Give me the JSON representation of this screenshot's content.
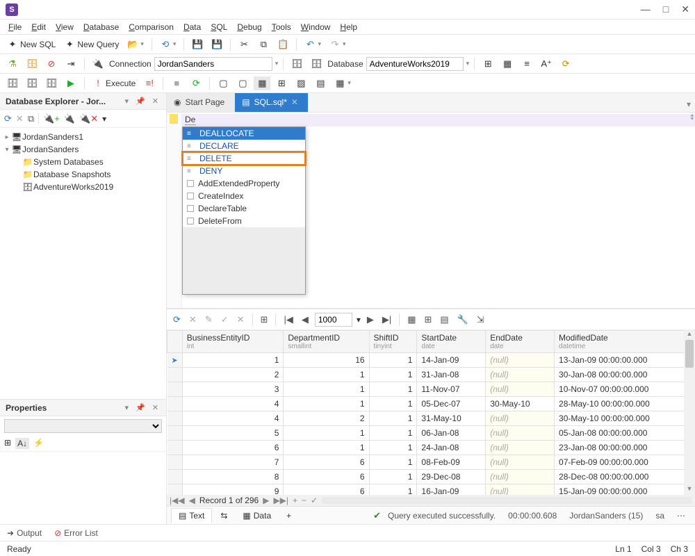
{
  "app_icon_letter": "S",
  "window": {
    "min": "—",
    "max": "□",
    "close": "✕"
  },
  "menu": [
    "File",
    "Edit",
    "View",
    "Database",
    "Comparison",
    "Data",
    "SQL",
    "Debug",
    "Tools",
    "Window",
    "Help"
  ],
  "toolbar1": {
    "new_sql": "New SQL",
    "new_query": "New Query"
  },
  "toolbar2": {
    "connection_label": "Connection",
    "connection_value": "JordanSanders",
    "database_label": "Database",
    "database_value": "AdventureWorks2019"
  },
  "toolbar3": {
    "execute": "Execute"
  },
  "explorer": {
    "title": "Database Explorer - Jor...",
    "nodes": [
      {
        "label": "JordanSanders1",
        "icon": "server"
      },
      {
        "label": "JordanSanders",
        "icon": "server",
        "expanded": true,
        "children": [
          {
            "label": "System Databases",
            "icon": "folder"
          },
          {
            "label": "Database Snapshots",
            "icon": "folder"
          },
          {
            "label": "AdventureWorks2019",
            "icon": "db"
          }
        ]
      }
    ]
  },
  "properties": {
    "title": "Properties"
  },
  "tabs": {
    "start": "Start Page",
    "sql": "SQL.sql*"
  },
  "editor": {
    "typed": "De"
  },
  "autocomplete": {
    "items": [
      {
        "label": "DEALLOCATE",
        "type": "kw",
        "sel": true
      },
      {
        "label": "DECLARE",
        "type": "kw"
      },
      {
        "label": "DELETE",
        "type": "kw",
        "highlight": true
      },
      {
        "label": "DENY",
        "type": "kw"
      },
      {
        "label": "AddExtendedProperty",
        "type": "snip"
      },
      {
        "label": "CreateIndex",
        "type": "snip"
      },
      {
        "label": "DeclareTable",
        "type": "snip"
      },
      {
        "label": "DeleteFrom",
        "type": "snip"
      }
    ]
  },
  "grid_toolbar": {
    "page_size": "1000"
  },
  "grid": {
    "columns": [
      {
        "name": "BusinessEntityID",
        "type": "int"
      },
      {
        "name": "DepartmentID",
        "type": "smallint"
      },
      {
        "name": "ShiftID",
        "type": "tinyint"
      },
      {
        "name": "StartDate",
        "type": "date"
      },
      {
        "name": "EndDate",
        "type": "date"
      },
      {
        "name": "ModifiedDate",
        "type": "datetime"
      }
    ],
    "rows": [
      [
        1,
        16,
        1,
        "14-Jan-09",
        null,
        "13-Jan-09 00:00:00.000"
      ],
      [
        2,
        1,
        1,
        "31-Jan-08",
        null,
        "30-Jan-08 00:00:00.000"
      ],
      [
        3,
        1,
        1,
        "11-Nov-07",
        null,
        "10-Nov-07 00:00:00.000"
      ],
      [
        4,
        1,
        1,
        "05-Dec-07",
        "30-May-10",
        "28-May-10 00:00:00.000"
      ],
      [
        4,
        2,
        1,
        "31-May-10",
        null,
        "30-May-10 00:00:00.000"
      ],
      [
        5,
        1,
        1,
        "06-Jan-08",
        null,
        "05-Jan-08 00:00:00.000"
      ],
      [
        6,
        1,
        1,
        "24-Jan-08",
        null,
        "23-Jan-08 00:00:00.000"
      ],
      [
        7,
        6,
        1,
        "08-Feb-09",
        null,
        "07-Feb-09 00:00:00.000"
      ],
      [
        8,
        6,
        1,
        "29-Dec-08",
        null,
        "28-Dec-08 00:00:00.000"
      ],
      [
        9,
        6,
        1,
        "16-Jan-09",
        null,
        "15-Jan-09 00:00:00.000"
      ]
    ]
  },
  "record_nav": "Record 1 of 296",
  "footer": {
    "text_tab": "Text",
    "data_tab": "Data",
    "status_msg": "Query executed successfully.",
    "elapsed": "00:00:00.608",
    "conn": "JordanSanders (15)",
    "user": "sa"
  },
  "bottom": {
    "output": "Output",
    "errors": "Error List"
  },
  "status": {
    "ready": "Ready",
    "ln": "Ln 1",
    "col": "Col 3",
    "ch": "Ch 3"
  }
}
